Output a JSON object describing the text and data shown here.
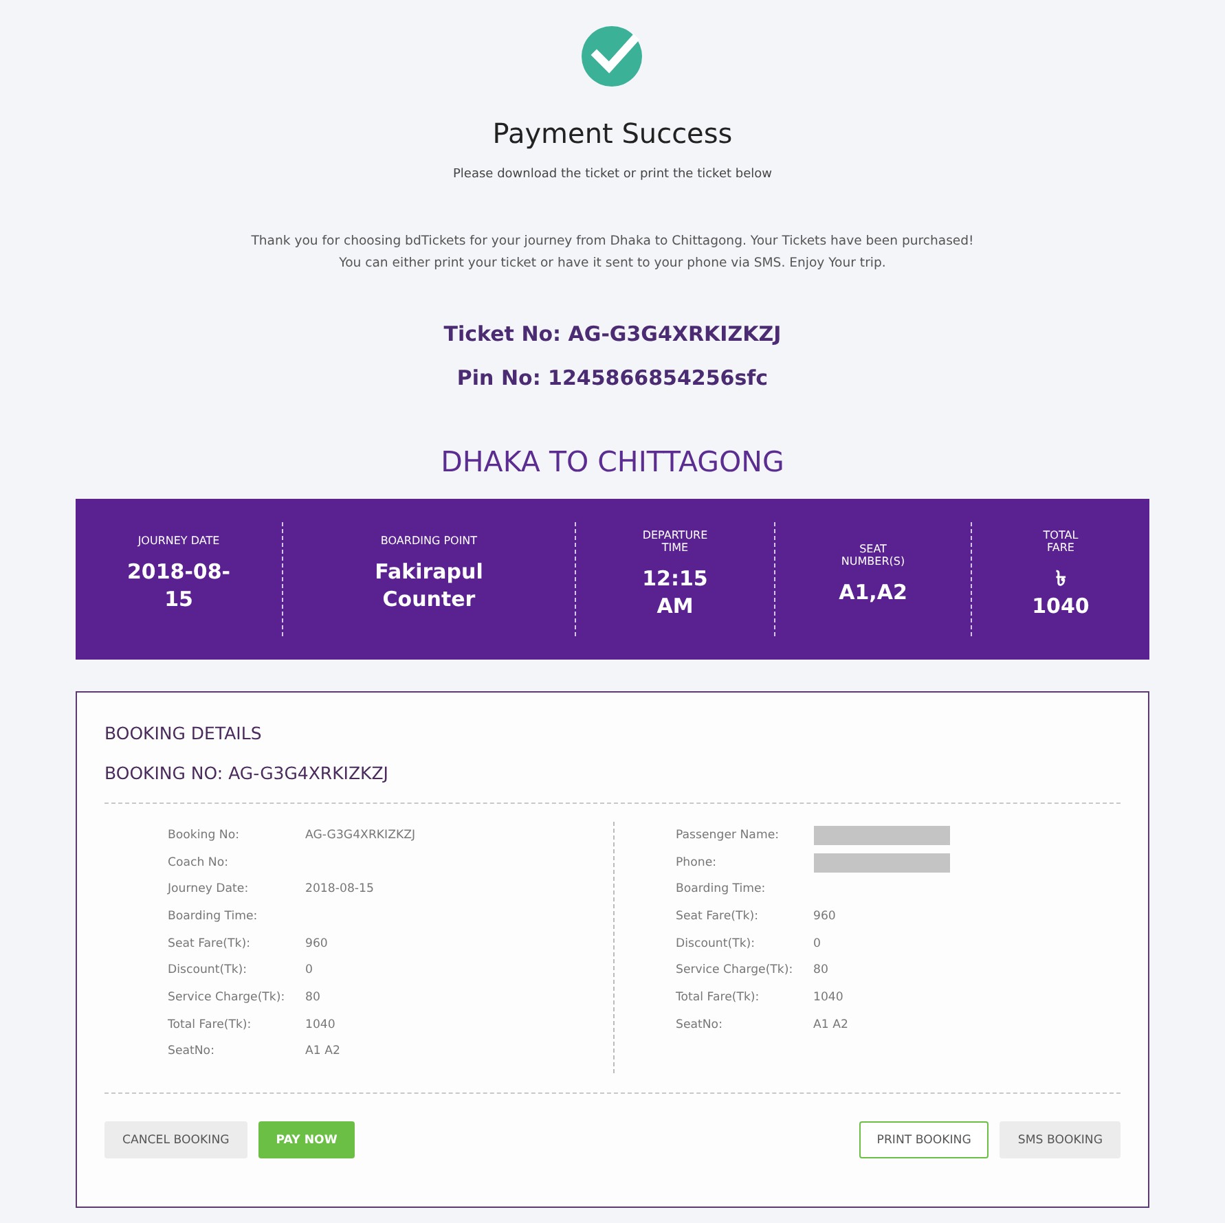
{
  "header": {
    "title": "Payment Success",
    "subtitle": "Please download the ticket or print the ticket below"
  },
  "message": [
    "Thank you for choosing bdTickets for your journey from Dhaka to Chittagong. Your Tickets have been purchased!",
    "You can either print your ticket or have it sent to your phone via SMS. Enjoy Your trip."
  ],
  "ticket": {
    "ticket_no": "Ticket No: AG-G3G4XRKIZKZJ",
    "pin_no": "Pin No: 1245866854256sfc"
  },
  "route": "DHAKA TO CHITTAGONG",
  "summary": [
    {
      "label": "JOURNEY DATE",
      "value": "2018-08-15"
    },
    {
      "label": "BOARDING POINT",
      "value": "Fakirapul Counter"
    },
    {
      "label": "DEPARTURE TIME",
      "value": "12:15 AM"
    },
    {
      "label": "SEAT NUMBER(S)",
      "value": "A1,A2"
    },
    {
      "label": "TOTAL FARE",
      "value": "৳ 1040"
    }
  ],
  "booking": {
    "title": "BOOKING DETAILS",
    "booking_no": "BOOKING NO: AG-G3G4XRKIZKZJ",
    "left_rows": [
      {
        "label": "Booking No:",
        "value": "AG-G3G4XRKIZKZJ",
        "redacted": false
      },
      {
        "label": "Coach No:",
        "redacted": false
      },
      {
        "label": "Journey Date:",
        "value": "2018-08-15",
        "redacted": false
      },
      {
        "label": "Boarding Time:",
        "redacted": false
      },
      {
        "label": "Seat Fare(Tk):",
        "value": "960",
        "redacted": false
      },
      {
        "label": "Discount(Tk):",
        "value": "0",
        "redacted": false
      },
      {
        "label": "Service Charge(Tk):",
        "value": "80",
        "redacted": false
      },
      {
        "label": "Total Fare(Tk):",
        "value": "1040",
        "redacted": false
      },
      {
        "label": "SeatNo:",
        "value": "A1 A2",
        "redacted": false
      }
    ],
    "right_rows": [
      {
        "label": "Passenger Name:",
        "redacted": true
      },
      {
        "label": "Phone:",
        "redacted": true
      },
      {
        "label": "Boarding Time:",
        "redacted": false
      },
      {
        "label": "Seat Fare(Tk):",
        "value": "960",
        "redacted": false
      },
      {
        "label": "Discount(Tk):",
        "value": "0",
        "redacted": false
      },
      {
        "label": "Service Charge(Tk):",
        "value": "80",
        "redacted": false
      },
      {
        "label": "Total Fare(Tk):",
        "value": "1040",
        "redacted": false
      },
      {
        "label": "SeatNo:",
        "value": "A1 A2",
        "redacted": false
      }
    ],
    "left_buttons": [
      {
        "label": "CANCEL BOOKING",
        "kind": "secondary"
      },
      {
        "label": "PAY NOW",
        "kind": "primary"
      }
    ],
    "right_buttons": [
      {
        "label": "PRINT BOOKING",
        "kind": "outline"
      },
      {
        "label": "SMS BOOKING",
        "kind": "secondary"
      }
    ]
  }
}
